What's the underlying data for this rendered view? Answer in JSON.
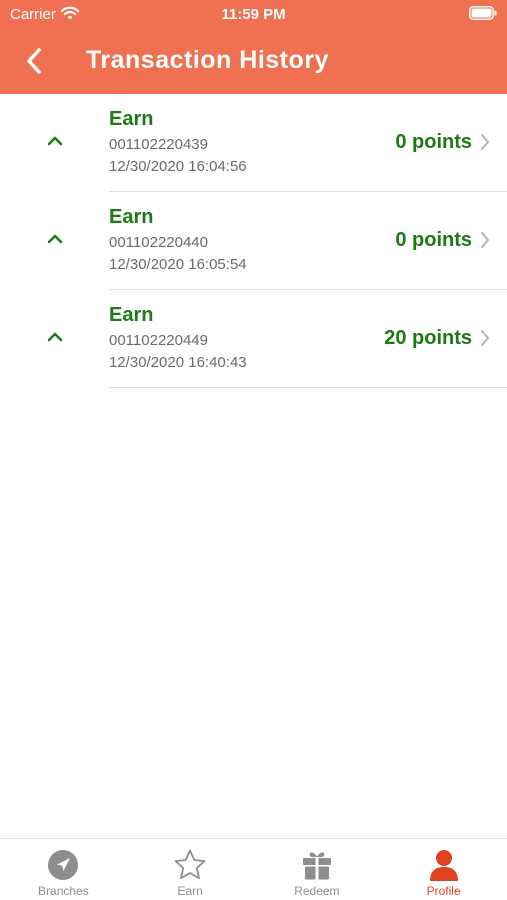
{
  "status_bar": {
    "carrier": "Carrier",
    "time": "11:59 PM"
  },
  "nav": {
    "title": "Transaction History",
    "back_icon": "chevron-left-icon"
  },
  "transactions": [
    {
      "type": "Earn",
      "id": "001102220439",
      "date": "12/30/2020 16:04:56",
      "points": "0 points",
      "icon": "chevron-up-icon"
    },
    {
      "type": "Earn",
      "id": "001102220440",
      "date": "12/30/2020 16:05:54",
      "points": "0 points",
      "icon": "chevron-up-icon"
    },
    {
      "type": "Earn",
      "id": "001102220449",
      "date": "12/30/2020 16:40:43",
      "points": "20 points",
      "icon": "chevron-up-icon"
    }
  ],
  "tabs": [
    {
      "label": "Branches",
      "icon": "navigation-arrow-icon",
      "active": false
    },
    {
      "label": "Earn",
      "icon": "star-icon",
      "active": false
    },
    {
      "label": "Redeem",
      "icon": "gift-icon",
      "active": false
    },
    {
      "label": "Profile",
      "icon": "person-icon",
      "active": true
    }
  ],
  "colors": {
    "header": "#ef7152",
    "accent_green": "#1c7a14",
    "active_tab": "#e0431f",
    "inactive_tab": "#8e8e8e"
  }
}
